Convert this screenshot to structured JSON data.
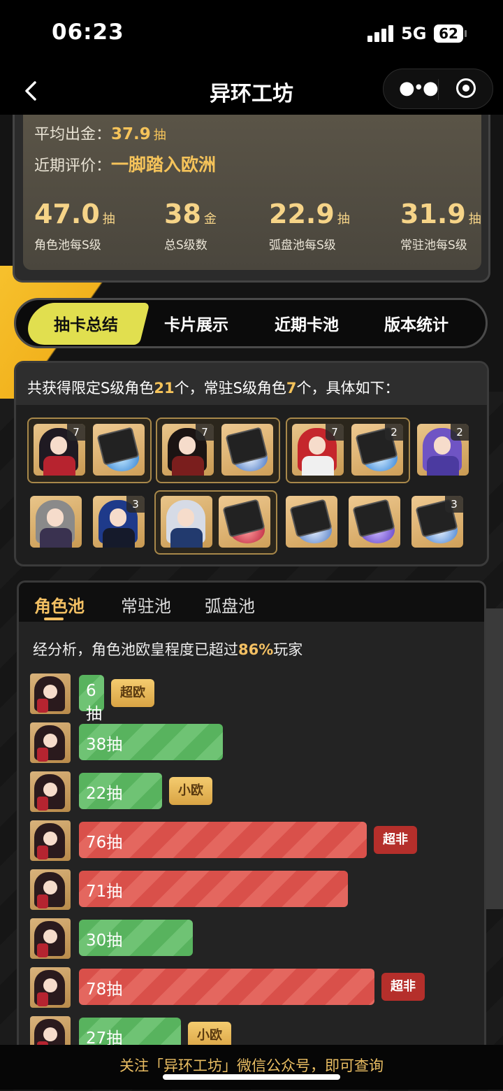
{
  "status_bar": {
    "time": "06:23",
    "network": "5G",
    "battery": "62"
  },
  "navbar": {
    "title": "异环工坊"
  },
  "summary": {
    "avg_label": "平均出金：",
    "avg_value": "37.9",
    "avg_unit": "抽",
    "rating_label": "近期评价：",
    "rating_value": "一脚踏入欧洲",
    "stats": [
      {
        "value": "47.0",
        "unit": "抽",
        "label": "角色池每S级"
      },
      {
        "value": "38",
        "unit": "金",
        "label": "总S级数"
      },
      {
        "value": "22.9",
        "unit": "抽",
        "label": "弧盘池每S级"
      },
      {
        "value": "31.9",
        "unit": "抽",
        "label": "常驻池每S级"
      }
    ]
  },
  "tabs": [
    "抽卡总结",
    "卡片展示",
    "近期卡池",
    "版本统计"
  ],
  "active_tab": "抽卡总结",
  "srank": {
    "text_a": "共获得限定S级角色",
    "limited_count": "21",
    "text_b": "个，常驻S级角色",
    "standard_count": "7",
    "text_c": "个，具体如下：",
    "badges": [
      "7",
      "7",
      "7",
      "2",
      "2",
      "3",
      "3"
    ]
  },
  "pool": {
    "tabs": [
      "角色池",
      "常驻池",
      "弧盘池"
    ],
    "active_tab": "角色池",
    "analysis_a": "经分析，角色池欧皇程度已超过",
    "analysis_pct": "86%",
    "analysis_b": "玩家",
    "pull_scale_max": 100,
    "pulls": [
      {
        "label": "6抽",
        "value": 6,
        "color": "green",
        "tag": "超欧",
        "tag_style": "gold"
      },
      {
        "label": "38抽",
        "value": 38,
        "color": "green",
        "tag": "",
        "tag_style": ""
      },
      {
        "label": "22抽",
        "value": 22,
        "color": "green",
        "tag": "小欧",
        "tag_style": "gold"
      },
      {
        "label": "76抽",
        "value": 76,
        "color": "red",
        "tag": "超非",
        "tag_style": "red"
      },
      {
        "label": "71抽",
        "value": 71,
        "color": "red",
        "tag": "",
        "tag_style": ""
      },
      {
        "label": "30抽",
        "value": 30,
        "color": "green",
        "tag": "",
        "tag_style": ""
      },
      {
        "label": "78抽",
        "value": 78,
        "color": "red",
        "tag": "超非",
        "tag_style": "red"
      },
      {
        "label": "27抽",
        "value": 27,
        "color": "green",
        "tag": "小欧",
        "tag_style": "gold"
      }
    ]
  },
  "footer": {
    "text": "关注「异环工坊」微信公众号，即可查询"
  }
}
